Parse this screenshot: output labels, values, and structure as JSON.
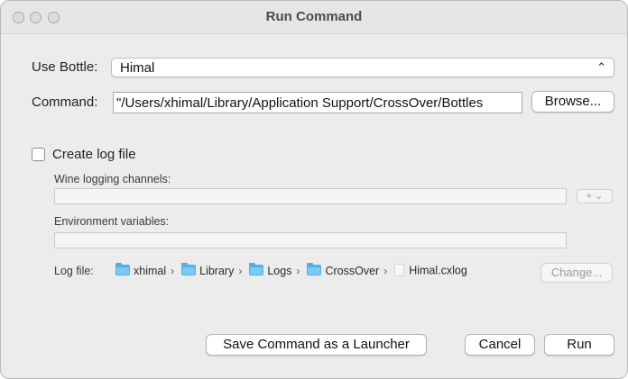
{
  "window": {
    "title": "Run Command"
  },
  "bottle": {
    "label": "Use Bottle:",
    "selected": "Himal"
  },
  "command": {
    "label": "Command:",
    "value": "\"/Users/xhimal/Library/Application Support/CrossOver/Bottles",
    "browse_label": "Browse..."
  },
  "log": {
    "checkbox_label": "Create log file",
    "wine_channels_label": "Wine logging channels:",
    "plus_label": "+ ⌄",
    "env_label": "Environment variables:",
    "logfile_label": "Log file:",
    "path": [
      "xhimal",
      "Library",
      "Logs",
      "CrossOver"
    ],
    "filename": "Himal.cxlog",
    "change_label": "Change..."
  },
  "actions": {
    "save_launcher": "Save Command as a Launcher",
    "cancel": "Cancel",
    "run": "Run"
  },
  "icons": {
    "folder": "folder-icon",
    "file": "file-icon",
    "chevron": "chevron-updown-icon"
  },
  "colors": {
    "folder": "#4fb0e8"
  }
}
